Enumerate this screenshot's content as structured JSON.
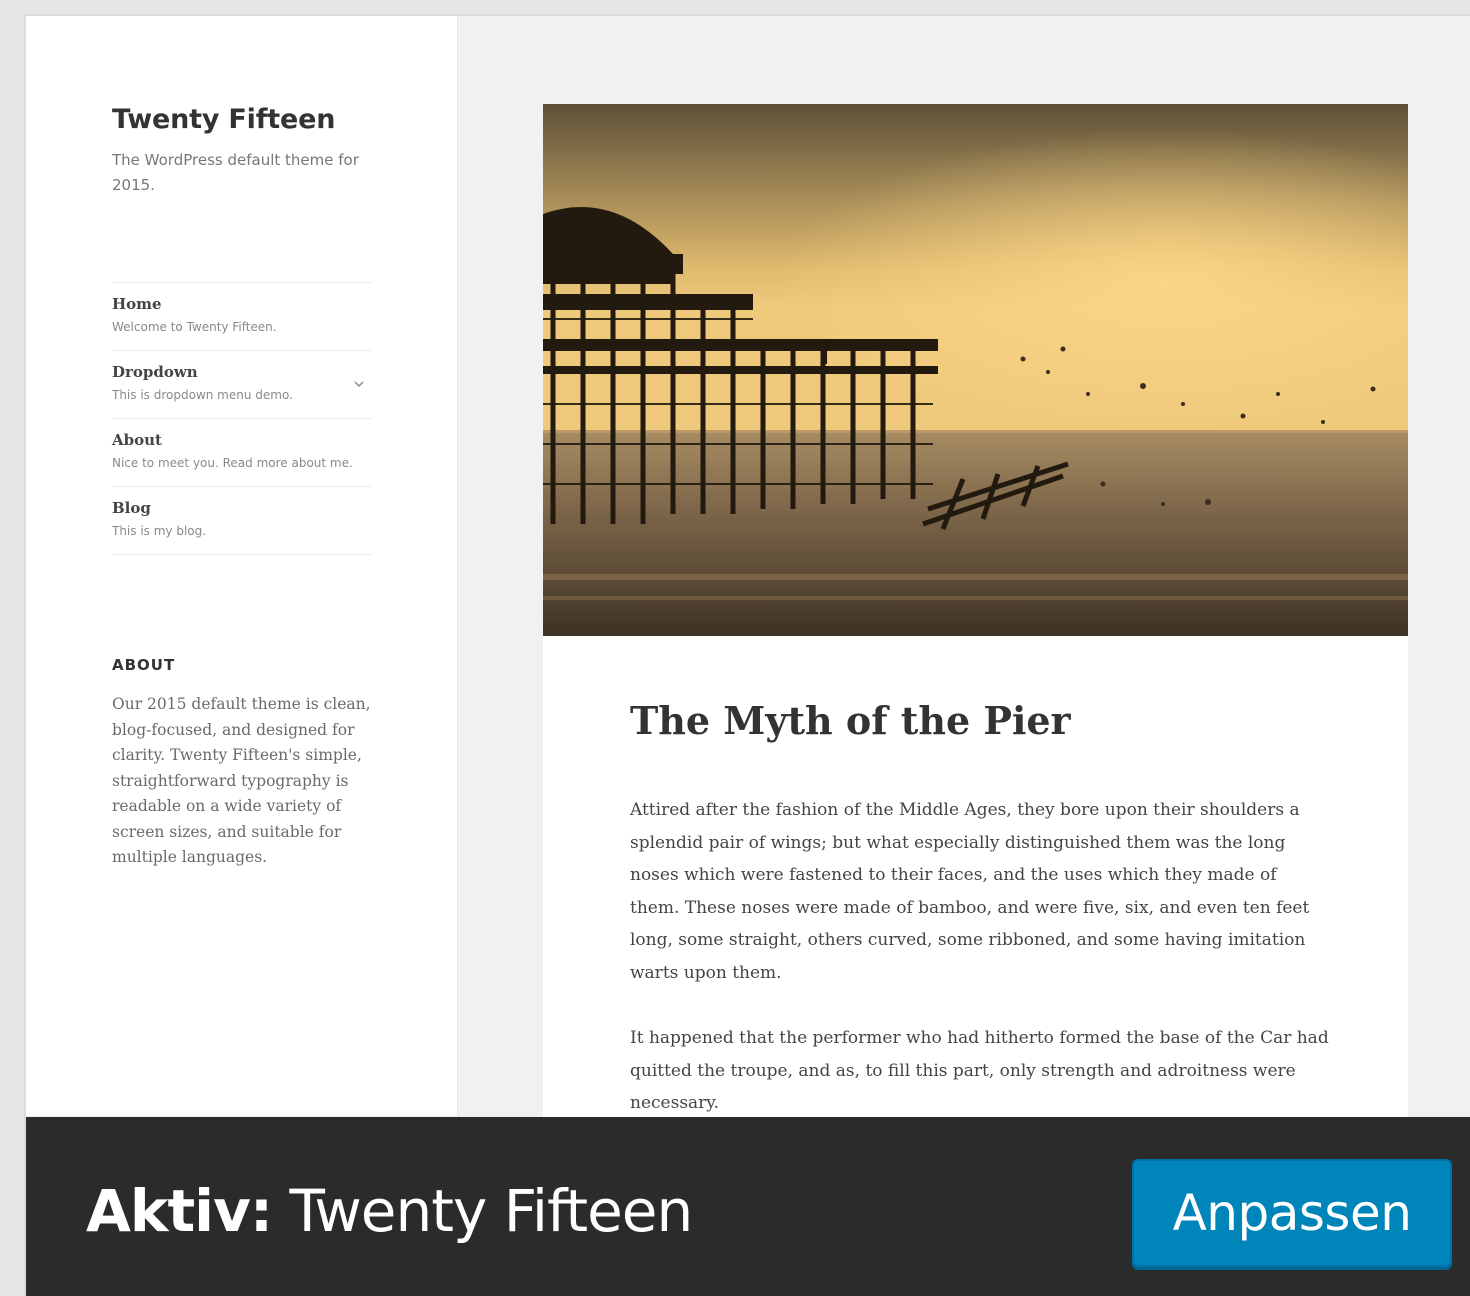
{
  "preview": {
    "site_title": "Twenty Fifteen",
    "site_description": "The WordPress default theme for 2015.",
    "menu": [
      {
        "label": "Home",
        "description": "Welcome to Twenty Fifteen."
      },
      {
        "label": "Dropdown",
        "description": "This is dropdown menu demo."
      },
      {
        "label": "About",
        "description": "Nice to meet you. Read more about me."
      },
      {
        "label": "Blog",
        "description": "This is my blog."
      }
    ],
    "widget_title": "ABOUT",
    "widget_text": "Our 2015 default theme is clean, blog-focused, and designed for clarity. Twenty Fifteen's simple, straightforward typography is readable on a wide variety of screen sizes, and suitable for multiple languages.",
    "post_title": "The Myth of the Pier",
    "post_paragraphs": [
      "Attired after the fashion of the Middle Ages, they bore upon their shoulders a splendid pair of wings; but what especially distinguished them was the long noses which were fastened to their faces, and the uses which they made of them. These noses were made of bamboo, and were five, six, and even ten feet long, some straight, others curved, some ribboned, and some having imitation warts upon them.",
      "It happened that the performer who had hitherto formed the base of the Car had quitted the troupe, and as, to fill this part, only strength and adroitness were necessary."
    ]
  },
  "active_bar": {
    "prefix": "Aktiv:",
    "theme_name": "Twenty Fifteen",
    "customize_label": "Anpassen"
  },
  "colors": {
    "bar_background": "#2b2b2b",
    "button_blue": "#0085ba"
  }
}
